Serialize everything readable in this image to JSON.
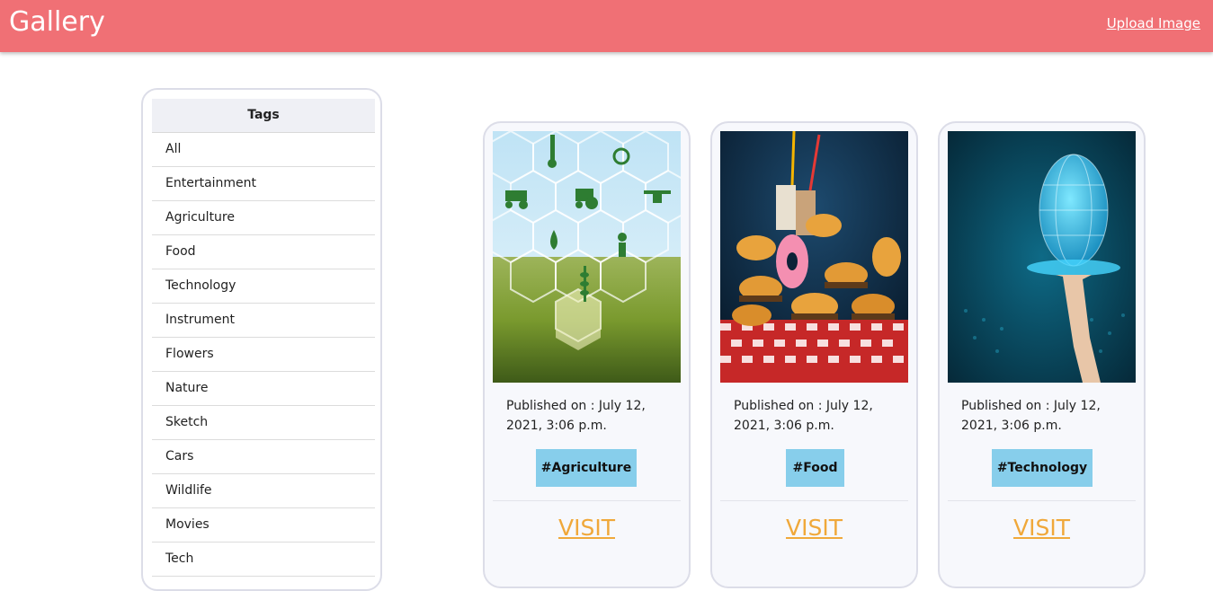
{
  "app": {
    "title": "Gallery",
    "upload_label": "Upload Image"
  },
  "sidebar": {
    "heading": "Tags",
    "items": [
      "All",
      "Entertainment",
      "Agriculture",
      "Food",
      "Technology",
      "Instrument",
      "Flowers",
      "Nature",
      "Sketch",
      "Cars",
      "Wildlife",
      "Movies",
      "Tech"
    ]
  },
  "cards": [
    {
      "image": "agriculture-image",
      "published": "Published on : July 12, 2021, 3:06 p.m.",
      "tag": "#Agriculture",
      "visit": "VISIT"
    },
    {
      "image": "food-image",
      "published": "Published on : July 12, 2021, 3:06 p.m.",
      "tag": "#Food",
      "visit": "VISIT"
    },
    {
      "image": "technology-image",
      "published": "Published on : July 12, 2021, 3:06 p.m.",
      "tag": "#Technology",
      "visit": "VISIT"
    }
  ],
  "colors": {
    "navbar": "#f07075",
    "badge": "#87ceeb",
    "visit": "#f0a83a"
  }
}
